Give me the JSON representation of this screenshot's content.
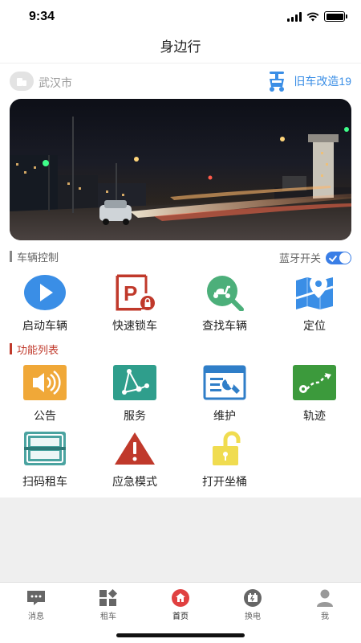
{
  "status_bar": {
    "time": "9:34"
  },
  "nav": {
    "title": "身边行"
  },
  "location": {
    "city": "武汉市",
    "promo_label": "旧车改造19"
  },
  "vehicle_control": {
    "title": "车辆控制",
    "bluetooth_label": "蓝牙开关",
    "bluetooth_on": true,
    "items": [
      {
        "label": "启动车辆",
        "icon": "play-icon"
      },
      {
        "label": "快速锁车",
        "icon": "parking-lock-icon"
      },
      {
        "label": "查找车辆",
        "icon": "find-scooter-icon"
      },
      {
        "label": "定位",
        "icon": "map-pin-icon"
      }
    ]
  },
  "features": {
    "title": "功能列表",
    "items": [
      {
        "label": "公告",
        "icon": "speaker-icon"
      },
      {
        "label": "服务",
        "icon": "network-icon"
      },
      {
        "label": "维护",
        "icon": "wrench-icon"
      },
      {
        "label": "轨迹",
        "icon": "route-icon"
      },
      {
        "label": "扫码租车",
        "icon": "scan-icon"
      },
      {
        "label": "应急模式",
        "icon": "warning-icon"
      },
      {
        "label": "打开坐桶",
        "icon": "unlock-icon"
      }
    ]
  },
  "tabs": [
    {
      "label": "消息",
      "icon": "message-icon"
    },
    {
      "label": "租车",
      "icon": "apps-icon"
    },
    {
      "label": "首页",
      "icon": "home-icon",
      "active": true
    },
    {
      "label": "换电",
      "icon": "battery-swap-icon"
    },
    {
      "label": "我",
      "icon": "user-icon"
    }
  ],
  "colors": {
    "accent_blue": "#3a8ee6",
    "control_bar": "#888888",
    "feature_red": "#c0392b",
    "active_tab": "#e04040"
  }
}
